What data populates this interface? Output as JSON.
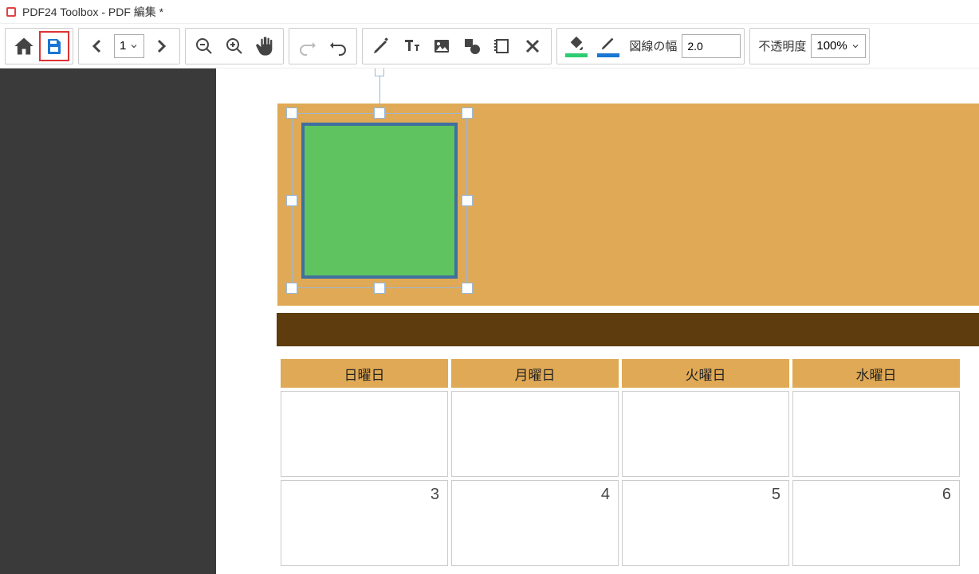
{
  "window": {
    "title": "PDF24 Toolbox - PDF 編集 *"
  },
  "toolbar": {
    "page_current": "1",
    "line_width_label": "図線の幅",
    "line_width_value": "2.0",
    "opacity_label": "不透明度",
    "opacity_value": "100%",
    "fill_color": "#2ecc71",
    "stroke_color": "#1976d2"
  },
  "calendar": {
    "headers": [
      "日曜日",
      "月曜日",
      "火曜日",
      "水曜日"
    ],
    "row1": [
      "",
      "",
      "",
      ""
    ],
    "row2": [
      "3",
      "4",
      "5",
      "6"
    ]
  }
}
